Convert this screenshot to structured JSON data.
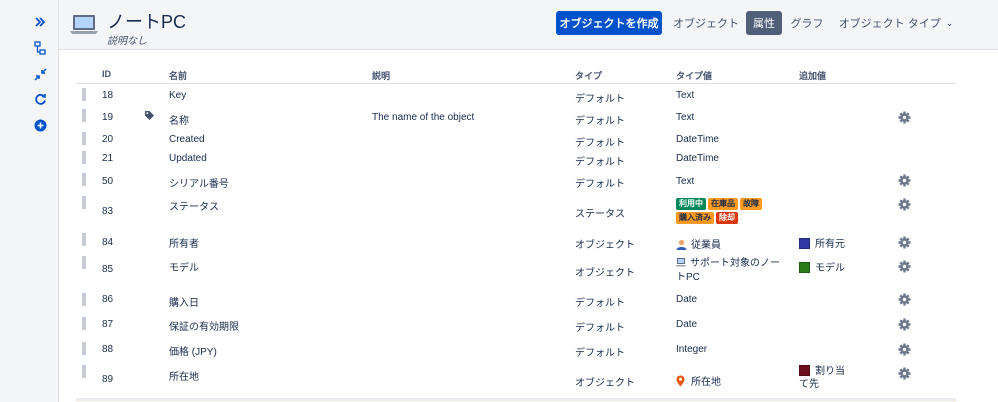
{
  "header": {
    "title": "ノートPC",
    "subtitle": "説明なし",
    "create_button": "オブジェクトを作成",
    "nav": [
      "オブジェクト",
      "属性",
      "グラフ",
      "オブジェクト タイプ"
    ],
    "active_nav": "属性"
  },
  "table": {
    "columns": {
      "id": "ID",
      "name": "名前",
      "description": "説明",
      "type": "タイプ",
      "type_value": "タイプ値",
      "additional": "追加値"
    },
    "rows": {
      "r0": {
        "id": "18",
        "name": "Key",
        "description": "",
        "type": "デフォルト",
        "type_value": "Text"
      },
      "r1": {
        "id": "19",
        "name": "名称",
        "description": "The name of the object",
        "type": "デフォルト",
        "type_value": "Text"
      },
      "r2": {
        "id": "20",
        "name": "Created",
        "description": "",
        "type": "デフォルト",
        "type_value": "DateTime"
      },
      "r3": {
        "id": "21",
        "name": "Updated",
        "description": "",
        "type": "デフォルト",
        "type_value": "DateTime"
      },
      "r4": {
        "id": "50",
        "name": "シリアル番号",
        "description": "",
        "type": "デフォルト",
        "type_value": "Text"
      },
      "r5": {
        "id": "83",
        "name": "ステータス",
        "description": "",
        "type": "ステータス",
        "statuses": [
          {
            "label": "利用中",
            "color": "#00875a"
          },
          {
            "label": "在庫品",
            "color": "#ff991f"
          },
          {
            "label": "故障",
            "color": "#ff991f"
          },
          {
            "label": "購入済み",
            "color": "#ff991f"
          },
          {
            "label": "除却",
            "color": "#de350b"
          }
        ]
      },
      "r6": {
        "id": "84",
        "name": "所有者",
        "description": "",
        "type": "オブジェクト",
        "type_value": "従業員",
        "type_icon": "person-icon",
        "additional": "所有元",
        "swatch": "#2f3aa8"
      },
      "r7": {
        "id": "85",
        "name": "モデル",
        "description": "",
        "type": "オブジェクト",
        "type_value_line1": "サポート対象のノー",
        "type_value_line2": "トPC",
        "type_icon": "laptop-icon",
        "additional": "モデル",
        "swatch": "#2a7a1a"
      },
      "r8": {
        "id": "86",
        "name": "購入日",
        "description": "",
        "type": "デフォルト",
        "type_value": "Date"
      },
      "r9": {
        "id": "87",
        "name": "保証の有効期限",
        "description": "",
        "type": "デフォルト",
        "type_value": "Date"
      },
      "r10": {
        "id": "88",
        "name": "価格 (JPY)",
        "description": "",
        "type": "デフォルト",
        "type_value": "Integer"
      },
      "r11": {
        "id": "89",
        "name": "所在地",
        "description": "",
        "type": "オブジェクト",
        "type_value": "所在地",
        "type_icon": "location-pin-icon",
        "additional_line1": "割り当",
        "additional_line2": "て先",
        "swatch": "#6b0f1a"
      }
    }
  },
  "colors": {
    "primary": "#0052cc",
    "active_tab": "#505f79",
    "rail_icon": "#0052cc",
    "gear": "#6b778c"
  }
}
